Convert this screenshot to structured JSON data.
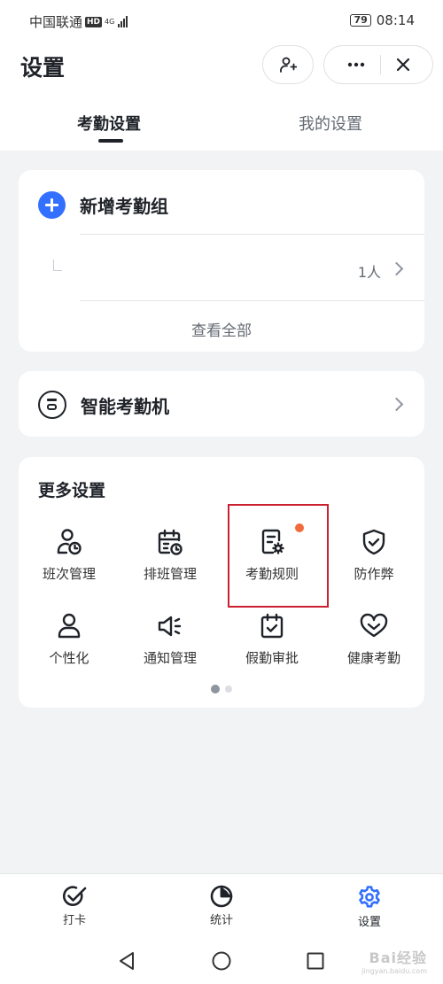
{
  "status_bar": {
    "carrier": "中国联通",
    "hd": "HD",
    "network": "4G",
    "battery": "79",
    "time": "08:14"
  },
  "header": {
    "title": "设置",
    "icons": [
      "add-person-icon",
      "more-icon",
      "close-icon"
    ]
  },
  "tabs": [
    {
      "label": "考勤设置",
      "active": true
    },
    {
      "label": "我的设置",
      "active": false
    }
  ],
  "group_card": {
    "add_label": "新增考勤组",
    "group_count": "1人",
    "view_all": "查看全部"
  },
  "device_card": {
    "label": "智能考勤机"
  },
  "more_settings": {
    "title": "更多设置",
    "items": [
      {
        "label": "班次管理",
        "icon": "shift-user-icon"
      },
      {
        "label": "排班管理",
        "icon": "schedule-calendar-icon"
      },
      {
        "label": "考勤规则",
        "icon": "rules-doc-icon",
        "highlighted": true,
        "badge": true
      },
      {
        "label": "防作弊",
        "icon": "shield-check-icon"
      },
      {
        "label": "个性化",
        "icon": "person-icon"
      },
      {
        "label": "通知管理",
        "icon": "speaker-icon"
      },
      {
        "label": "假勤审批",
        "icon": "calendar-check-icon"
      },
      {
        "label": "健康考勤",
        "icon": "heart-icon"
      }
    ],
    "page": 1,
    "pages": 2
  },
  "bottom_nav": [
    {
      "label": "打卡",
      "icon": "check-icon",
      "active": false
    },
    {
      "label": "统计",
      "icon": "pie-chart-icon",
      "active": false
    },
    {
      "label": "设置",
      "icon": "gear-icon",
      "active": true
    }
  ],
  "watermark": {
    "text": "Bai经验",
    "sub": "jingyan.baidu.com"
  },
  "colors": {
    "accent": "#3370ff",
    "highlight_border": "#cc1f2f",
    "badge": "#f26b3a",
    "background": "#f2f3f5"
  }
}
